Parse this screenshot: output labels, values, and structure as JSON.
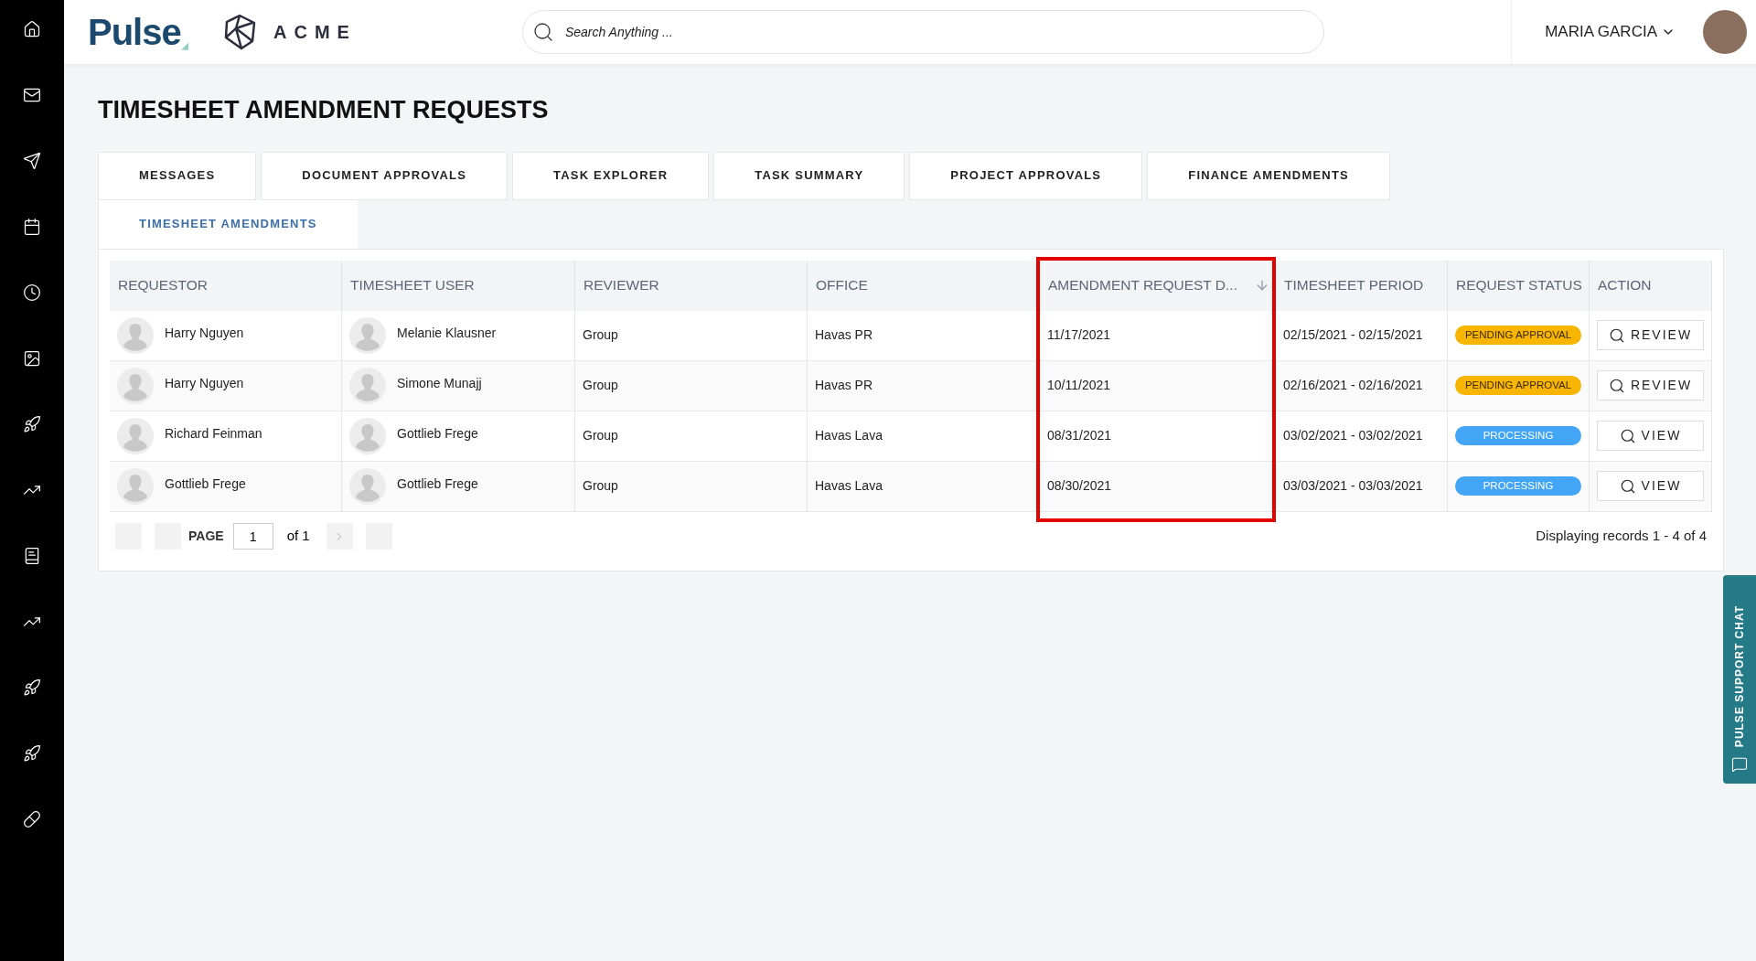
{
  "header": {
    "logo": "Pulse",
    "brand": "ACME",
    "search": {
      "placeholder": "Search Anything ..."
    },
    "user_name": "MARIA GARCIA"
  },
  "page_title": "TIMESHEET AMENDMENT REQUESTS",
  "tabs": [
    {
      "label": "MESSAGES",
      "selected": false
    },
    {
      "label": "DOCUMENT APPROVALS",
      "selected": false
    },
    {
      "label": "TASK EXPLORER",
      "selected": false
    },
    {
      "label": "TASK SUMMARY",
      "selected": false
    },
    {
      "label": "PROJECT APPROVALS",
      "selected": false
    },
    {
      "label": "FINANCE AMENDMENTS",
      "selected": false
    },
    {
      "label": "TIMESHEET AMENDMENTS",
      "selected": true
    }
  ],
  "table": {
    "columns": [
      {
        "label": "REQUESTOR",
        "sorted": false,
        "highlighted": false
      },
      {
        "label": "TIMESHEET USER",
        "sorted": false,
        "highlighted": false
      },
      {
        "label": "REVIEWER",
        "sorted": false,
        "highlighted": false
      },
      {
        "label": "OFFICE",
        "sorted": false,
        "highlighted": false
      },
      {
        "label": "AMENDMENT REQUEST D...",
        "sorted": true,
        "highlighted": true
      },
      {
        "label": "TIMESHEET PERIOD",
        "sorted": false,
        "highlighted": false
      },
      {
        "label": "REQUEST STATUS",
        "sorted": false,
        "highlighted": false
      },
      {
        "label": "ACTION",
        "sorted": false,
        "highlighted": false
      }
    ],
    "rows": [
      {
        "requestor": "Harry Nguyen",
        "timesheet_user": "Melanie Klausner",
        "reviewer": "Group",
        "office": "Havas PR",
        "request_date": "11/17/2021",
        "period": "02/15/2021 - 02/15/2021",
        "status": {
          "label": "PENDING APPROVAL",
          "kind": "pending"
        },
        "action": "REVIEW"
      },
      {
        "requestor": "Harry Nguyen",
        "timesheet_user": "Simone Munajj",
        "reviewer": "Group",
        "office": "Havas PR",
        "request_date": "10/11/2021",
        "period": "02/16/2021 - 02/16/2021",
        "status": {
          "label": "PENDING APPROVAL",
          "kind": "pending"
        },
        "action": "REVIEW"
      },
      {
        "requestor": "Richard Feinman",
        "timesheet_user": "Gottlieb Frege",
        "reviewer": "Group",
        "office": "Havas Lava",
        "request_date": "08/31/2021",
        "period": "03/02/2021 - 03/02/2021",
        "status": {
          "label": "PROCESSING",
          "kind": "processing"
        },
        "action": "VIEW"
      },
      {
        "requestor": "Gottlieb Frege",
        "timesheet_user": "Gottlieb Frege",
        "reviewer": "Group",
        "office": "Havas Lava",
        "request_date": "08/30/2021",
        "period": "03/03/2021 - 03/03/2021",
        "status": {
          "label": "PROCESSING",
          "kind": "processing"
        },
        "action": "VIEW"
      }
    ]
  },
  "pagination": {
    "page_label": "PAGE",
    "page": "1",
    "of": "of 1",
    "records": "Displaying records 1 - 4 of 4"
  },
  "support_chat": "PULSE SUPPORT CHAT"
}
